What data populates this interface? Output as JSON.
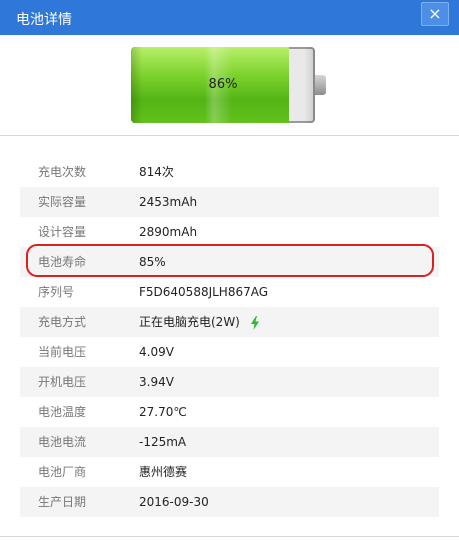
{
  "window": {
    "title": "电池详情",
    "close_label": "×"
  },
  "battery": {
    "percent_label": "86%",
    "level": 0.86
  },
  "rows": [
    {
      "label": "充电次数",
      "value": "814次"
    },
    {
      "label": "实际容量",
      "value": "2453mAh"
    },
    {
      "label": "设计容量",
      "value": "2890mAh"
    },
    {
      "label": "电池寿命",
      "value": "85%"
    },
    {
      "label": "序列号",
      "value": "F5D640588JLH867AG"
    },
    {
      "label": "充电方式",
      "value": "正在电脑充电(2W)"
    },
    {
      "label": "当前电压",
      "value": "4.09V"
    },
    {
      "label": "开机电压",
      "value": "3.94V"
    },
    {
      "label": "电池温度",
      "value": "27.70℃"
    },
    {
      "label": "电池电流",
      "value": "-125mA"
    },
    {
      "label": "电池厂商",
      "value": "惠州德赛"
    },
    {
      "label": "生产日期",
      "value": "2016-09-30"
    }
  ],
  "colors": {
    "titlebar": "#2f77d8",
    "highlight": "#dd1f1f",
    "bolt": "#2eb82e"
  }
}
